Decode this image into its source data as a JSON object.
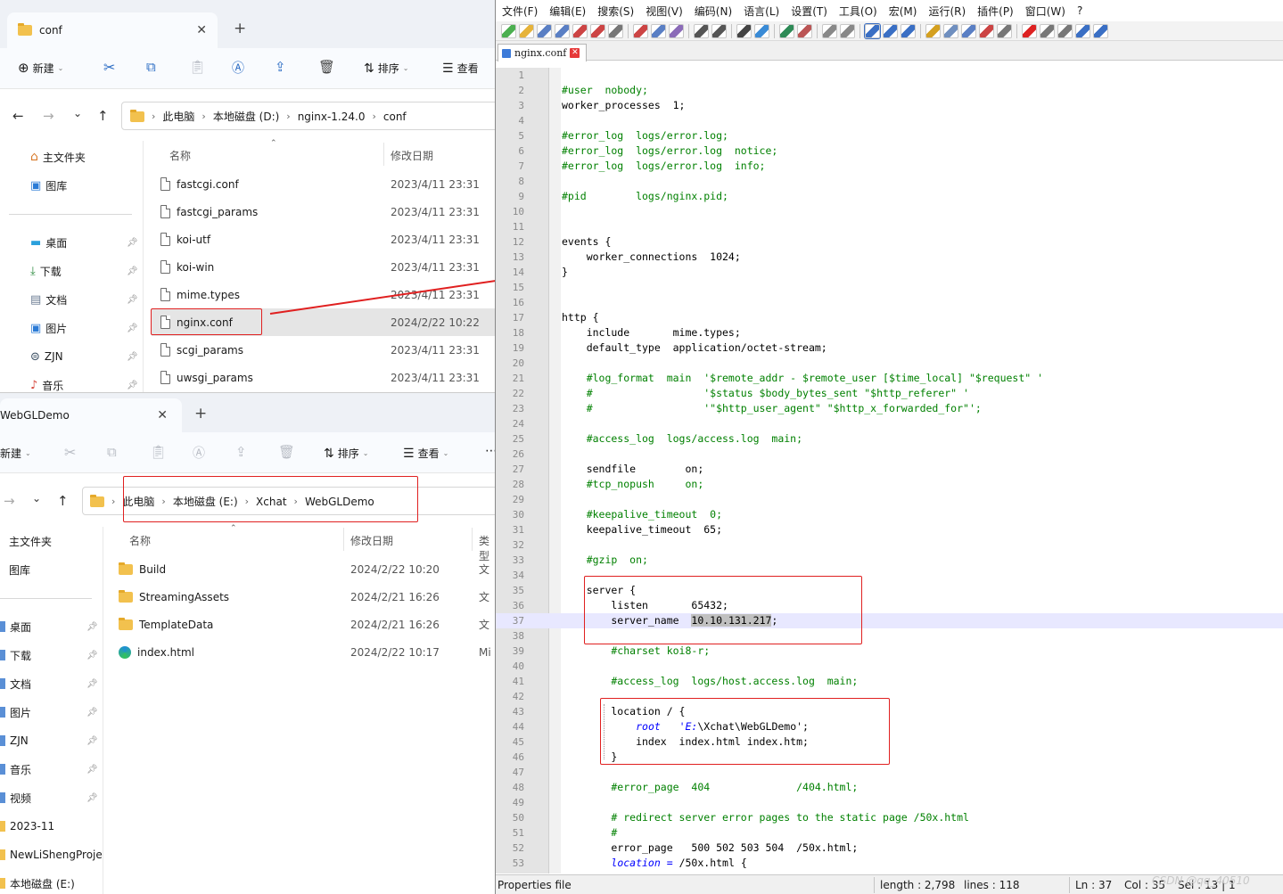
{
  "explorer_top": {
    "tab_title": "conf",
    "toolbar": {
      "new_label": "新建",
      "sort_label": "排序",
      "view_label": "查看"
    },
    "breadcrumb": [
      "此电脑",
      "本地磁盘 (D:)",
      "nginx-1.24.0",
      "conf"
    ],
    "sidebar": {
      "home": "主文件夹",
      "gallery": "图库",
      "items": [
        "桌面",
        "下载",
        "文档",
        "图片",
        "ZJN",
        "音乐"
      ]
    },
    "columns": {
      "name": "名称",
      "date": "修改日期"
    },
    "files": [
      {
        "name": "fastcgi.conf",
        "date": "2023/4/11 23:31"
      },
      {
        "name": "fastcgi_params",
        "date": "2023/4/11 23:31"
      },
      {
        "name": "koi-utf",
        "date": "2023/4/11 23:31"
      },
      {
        "name": "koi-win",
        "date": "2023/4/11 23:31"
      },
      {
        "name": "mime.types",
        "date": "2023/4/11 23:31"
      },
      {
        "name": "nginx.conf",
        "date": "2024/2/22 10:22"
      },
      {
        "name": "scgi_params",
        "date": "2023/4/11 23:31"
      },
      {
        "name": "uwsgi_params",
        "date": "2023/4/11 23:31"
      }
    ]
  },
  "explorer_bottom": {
    "tab_title": "WebGLDemo",
    "toolbar": {
      "new_label": "新建",
      "sort_label": "排序",
      "view_label": "查看"
    },
    "breadcrumb": [
      "此电脑",
      "本地磁盘 (E:)",
      "Xchat",
      "WebGLDemo"
    ],
    "sidebar": {
      "home": "主文件夹",
      "gallery": "图库",
      "items": [
        "桌面",
        "下载",
        "文档",
        "图片",
        "ZJN",
        "音乐",
        "视频",
        "2023-11",
        "NewLiShengProje",
        "本地磁盘 (E:)"
      ]
    },
    "columns": {
      "name": "名称",
      "date": "修改日期",
      "type": "类型"
    },
    "files": [
      {
        "name": "Build",
        "date": "2024/2/22 10:20",
        "type": "文"
      },
      {
        "name": "StreamingAssets",
        "date": "2024/2/21 16:26",
        "type": "文"
      },
      {
        "name": "TemplateData",
        "date": "2024/2/21 16:26",
        "type": "文"
      },
      {
        "name": "index.html",
        "date": "2024/2/22 10:17",
        "type": "Mi"
      }
    ]
  },
  "notepad": {
    "menu": [
      "文件(F)",
      "编辑(E)",
      "搜索(S)",
      "视图(V)",
      "编码(N)",
      "语言(L)",
      "设置(T)",
      "工具(O)",
      "宏(M)",
      "运行(R)",
      "插件(P)",
      "窗口(W)",
      "?"
    ],
    "tab_name": "nginx.conf",
    "current_line": 37,
    "selected_text": "10.10.131.217",
    "lines": [
      "",
      "#user  nobody;",
      "worker_processes  1;",
      "",
      "#error_log  logs/error.log;",
      "#error_log  logs/error.log  notice;",
      "#error_log  logs/error.log  info;",
      "",
      "#pid        logs/nginx.pid;",
      "",
      "",
      "events {",
      "    worker_connections  1024;",
      "}",
      "",
      "",
      "http {",
      "    include       mime.types;",
      "    default_type  application/octet-stream;",
      "",
      "    #log_format  main  '$remote_addr - $remote_user [$time_local] \"$request\" '",
      "    #                  '$status $body_bytes_sent \"$http_referer\" '",
      "    #                  '\"$http_user_agent\" \"$http_x_forwarded_for\"';",
      "",
      "    #access_log  logs/access.log  main;",
      "",
      "    sendfile        on;",
      "    #tcp_nopush     on;",
      "",
      "    #keepalive_timeout  0;",
      "    keepalive_timeout  65;",
      "",
      "    #gzip  on;",
      "",
      "    server {",
      "        listen       65432;",
      "        server_name  10.10.131.217;",
      "",
      "        #charset koi8-r;",
      "",
      "        #access_log  logs/host.access.log  main;",
      "",
      "        location / {",
      "            root   'E:\\Xchat\\WebGLDemo';",
      "            index  index.html index.htm;",
      "        }",
      "",
      "        #error_page  404              /404.html;",
      "",
      "        # redirect server error pages to the static page /50x.html",
      "        #",
      "        error_page   500 502 503 504  /50x.html;",
      "        location = /50x.html {"
    ],
    "status": {
      "file_type": "Properties file",
      "length": "length : 2,798",
      "lines": "lines : 118",
      "ln": "Ln : 37",
      "col": "Col : 35",
      "sel": "Sel : 13 | 1"
    },
    "watermark": "CSDN @qq_40510"
  },
  "colors": {
    "comment": "#008000",
    "keyword": "#0000ff",
    "annotation": "#e02020",
    "selection": "#c0c0c0"
  }
}
